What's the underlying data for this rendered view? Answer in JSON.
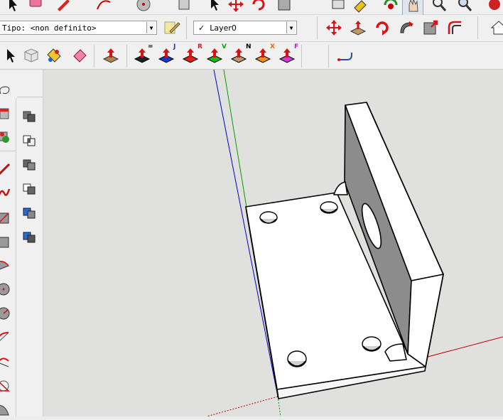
{
  "entity_info": {
    "type_label": "Tipo: <non definito>"
  },
  "layer": {
    "current": "Layer0",
    "checked_mark": "✓"
  },
  "axis_letters": {
    "push_equal": "=",
    "blue": "J",
    "red": "R",
    "green": "V",
    "normal": "N",
    "x": "X",
    "free": "F"
  },
  "colors": {
    "toolbar_bg": "#f0f0f0",
    "viewport_bg": "#e0e0df",
    "axis_red": "#c00000",
    "axis_green": "#00a000",
    "axis_blue": "#0000c0",
    "model_face": "#ffffff",
    "model_shadow": "#8c8c8c"
  },
  "icons": {
    "top_row": [
      "eraser-icon",
      "pencil-icon",
      "arc-icon",
      "circle-icon",
      "select-icon",
      "tape-icon",
      "paint-icon",
      "orbit-icon",
      "pan-icon",
      "zoom-icon",
      "zoom-extents-icon",
      "warehouse-icon"
    ],
    "move_tools": [
      "move-icon",
      "push-pull-icon",
      "rotate-icon",
      "follow-me-icon",
      "scale-icon",
      "offset-icon"
    ],
    "left_tools": [
      "lasso-icon",
      "section-icon",
      "component-icon",
      "line-icon",
      "freehand-icon",
      "rectangle-icon",
      "rect-rotated-icon",
      "arc-icon",
      "pie-icon",
      "circle-icon",
      "polygon-icon",
      "bezier-icon",
      "triangle-icon",
      "slice-icon"
    ],
    "left_tools_col2": [
      "solid-union-icon",
      "solid-intersect-icon",
      "solid-subtract-icon",
      "solid-trim-icon",
      "solid-split-icon",
      "solid-outer-icon"
    ]
  }
}
